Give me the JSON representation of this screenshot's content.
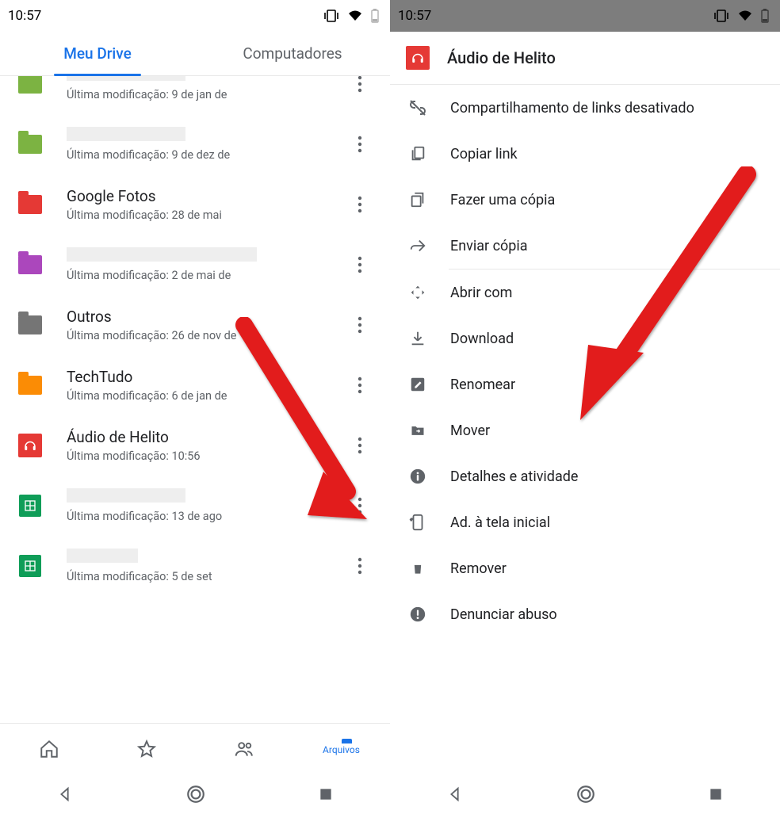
{
  "statusbar": {
    "time": "10:57"
  },
  "tabs": {
    "left": "Meu Drive",
    "right": "Computadores"
  },
  "mod_prefix": "Última modificação: ",
  "rows": [
    {
      "title_redacted": true,
      "mod": "9 de jan de",
      "icon": "folder",
      "color": "f-green"
    },
    {
      "title_redacted": true,
      "mod": "9 de dez de",
      "icon": "folder",
      "color": "f-green"
    },
    {
      "title": "Google Fotos",
      "mod": "28 de mai",
      "icon": "folder",
      "color": "f-red"
    },
    {
      "title_redacted": true,
      "mod": "2 de mai de",
      "icon": "folder",
      "color": "f-purple",
      "redacted_w": "wide"
    },
    {
      "title": "Outros",
      "mod": "26 de nov de",
      "icon": "folder",
      "color": "f-gray"
    },
    {
      "title": "TechTudo",
      "mod": "6 de jan de",
      "icon": "folder",
      "color": "f-orange"
    },
    {
      "title": "Áudio de Helito",
      "mod": "10:56",
      "icon": "audio"
    },
    {
      "title_redacted": true,
      "mod": "13 de ago",
      "icon": "sheets"
    },
    {
      "title_redacted": true,
      "mod": "5 de set",
      "icon": "sheets",
      "redacted_w": "short"
    }
  ],
  "bottomnav": {
    "files": "Arquivos"
  },
  "menu": {
    "header": "Áudio de Helito",
    "items": [
      {
        "icon": "link-off",
        "label": "Compartilhamento de links desativado"
      },
      {
        "icon": "copy-link",
        "label": "Copiar link"
      },
      {
        "icon": "copy",
        "label": "Fazer uma cópia"
      },
      {
        "icon": "send",
        "label": "Enviar cópia"
      },
      {
        "sep": true
      },
      {
        "icon": "open-with",
        "label": "Abrir com"
      },
      {
        "icon": "download",
        "label": "Download"
      },
      {
        "icon": "rename",
        "label": "Renomear"
      },
      {
        "icon": "move",
        "label": "Mover"
      },
      {
        "icon": "info",
        "label": "Detalhes e atividade"
      },
      {
        "icon": "add-home",
        "label": "Ad. à tela inicial"
      },
      {
        "icon": "trash",
        "label": "Remover"
      },
      {
        "icon": "report",
        "label": "Denunciar abuso"
      }
    ]
  }
}
